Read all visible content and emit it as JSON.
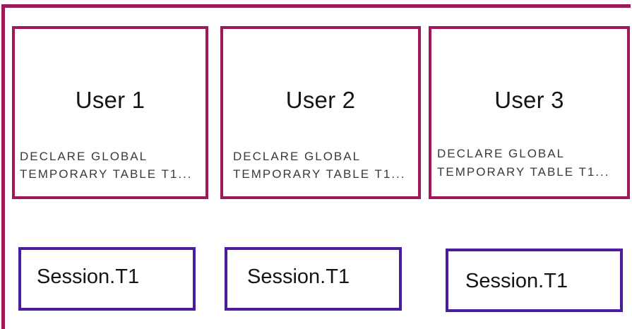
{
  "colors": {
    "outer_frame": "#9c1a57",
    "user_box_border": "#a0185a",
    "session_box_border": "#4b1d9e",
    "text": "#151515"
  },
  "users": [
    {
      "title": "User 1",
      "sql_line1": "DECLARE GLOBAL",
      "sql_line2": "TEMPORARY TABLE T1..."
    },
    {
      "title": "User 2",
      "sql_line1": "DECLARE GLOBAL",
      "sql_line2": "TEMPORARY TABLE T1..."
    },
    {
      "title": "User 3",
      "sql_line1": "DECLARE GLOBAL",
      "sql_line2": "TEMPORARY TABLE T1..."
    }
  ],
  "sessions": [
    {
      "label": "Session.T1"
    },
    {
      "label": "Session.T1"
    },
    {
      "label": "Session.T1"
    }
  ]
}
